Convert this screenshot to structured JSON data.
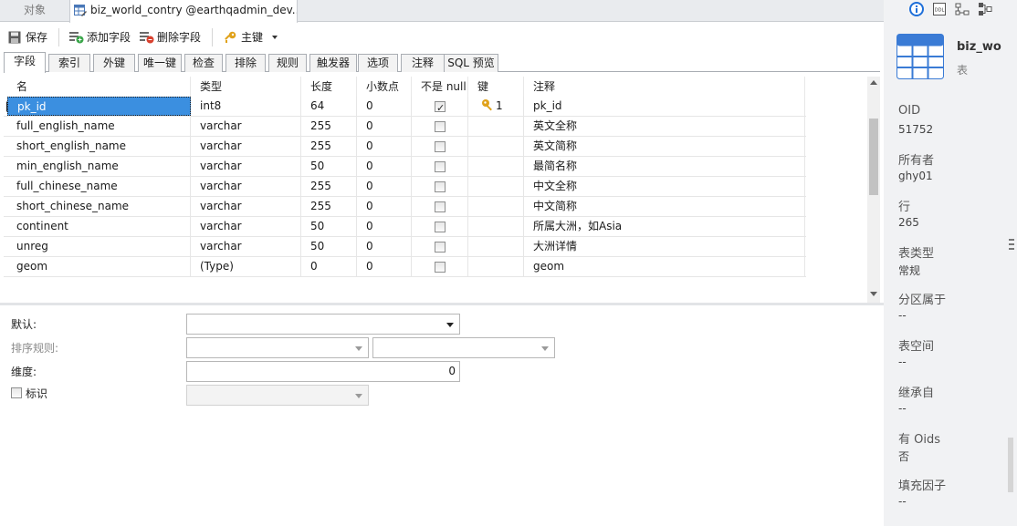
{
  "doc_tabs": {
    "objects": "对象",
    "table_tab": "biz_world_contry @earthqadmin_dev..."
  },
  "toolbar": {
    "save": "保存",
    "add_field": "添加字段",
    "delete_field": "删除字段",
    "primary_key": "主键"
  },
  "editor_tabs": [
    "字段",
    "索引",
    "外键",
    "唯一键",
    "检查",
    "排除",
    "规则",
    "触发器",
    "选项",
    "注释",
    "SQL 预览"
  ],
  "grid": {
    "columns": [
      "名",
      "类型",
      "长度",
      "小数点",
      "不是 null",
      "键",
      "注释"
    ],
    "rows": [
      {
        "name": "pk_id",
        "type": "int8",
        "length": "64",
        "decimal": "0",
        "not_null": true,
        "key": "1",
        "comment": "pk_id"
      },
      {
        "name": "full_english_name",
        "type": "varchar",
        "length": "255",
        "decimal": "0",
        "not_null": false,
        "key": "",
        "comment": "英文全称"
      },
      {
        "name": "short_english_name",
        "type": "varchar",
        "length": "255",
        "decimal": "0",
        "not_null": false,
        "key": "",
        "comment": "英文简称"
      },
      {
        "name": "min_english_name",
        "type": "varchar",
        "length": "50",
        "decimal": "0",
        "not_null": false,
        "key": "",
        "comment": "最简名称"
      },
      {
        "name": "full_chinese_name",
        "type": "varchar",
        "length": "255",
        "decimal": "0",
        "not_null": false,
        "key": "",
        "comment": "中文全称"
      },
      {
        "name": "short_chinese_name",
        "type": "varchar",
        "length": "255",
        "decimal": "0",
        "not_null": false,
        "key": "",
        "comment": "中文简称"
      },
      {
        "name": "continent",
        "type": "varchar",
        "length": "50",
        "decimal": "0",
        "not_null": false,
        "key": "",
        "comment": "所属大洲，如Asia"
      },
      {
        "name": "unreg",
        "type": "varchar",
        "length": "50",
        "decimal": "0",
        "not_null": false,
        "key": "",
        "comment": "大洲详情"
      },
      {
        "name": "geom",
        "type": "(Type)",
        "length": "0",
        "decimal": "0",
        "not_null": false,
        "key": "",
        "comment": "geom"
      }
    ]
  },
  "form": {
    "default_label": "默认:",
    "collation_label": "排序规则:",
    "dimension_label": "维度:",
    "dimension_value": "0",
    "identity_label": "标识"
  },
  "info_panel": {
    "object_name": "biz_wo",
    "object_type": "表",
    "fields": [
      {
        "label": "OID",
        "value": "51752"
      },
      {
        "label": "所有者",
        "value": "ghy01"
      },
      {
        "label": "行",
        "value": "265"
      },
      {
        "label": "表类型",
        "value": "常规"
      },
      {
        "label": "分区属于",
        "value": "--"
      },
      {
        "label": "表空间",
        "value": "--"
      },
      {
        "label": "继承自",
        "value": "--"
      },
      {
        "label": "有 Oids",
        "value": "否"
      },
      {
        "label": "填充因子",
        "value": "--"
      }
    ]
  },
  "colors": {
    "selection": "#3b8fe0",
    "panel_bg": "#f1f2f4",
    "table_icon": "#3a7bd5",
    "info_icon": "#1e6fd9"
  }
}
